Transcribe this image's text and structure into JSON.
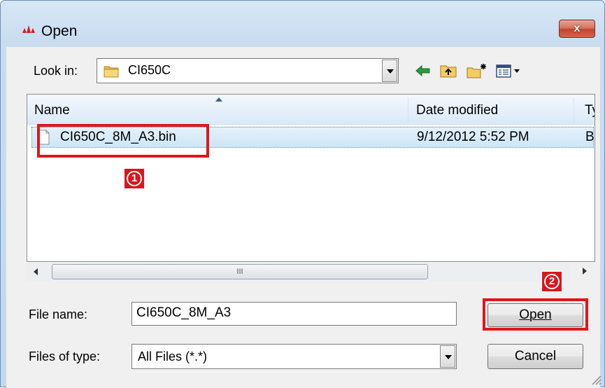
{
  "window": {
    "title": "Open",
    "close_label": "x"
  },
  "look_in": {
    "label": "Look in:",
    "folder": "CI650C",
    "folder_icon": "folder-icon"
  },
  "toolbar": {
    "back_icon": "back-arrow-icon",
    "up_icon": "up-folder-icon",
    "new_folder_icon": "new-folder-icon",
    "views_icon": "views-menu-icon"
  },
  "file_list": {
    "columns": [
      "Name",
      "Date modified",
      "Ty"
    ],
    "rows": [
      {
        "name": "CI650C_8M_A3.bin",
        "date_modified": "9/12/2012 5:52 PM",
        "type": "BI"
      }
    ]
  },
  "scrollbar": {
    "thumb_grip": "III"
  },
  "file_name": {
    "label": "File name:",
    "value": "CI650C_8M_A3"
  },
  "file_type": {
    "label": "Files of type:",
    "value": "All Files (*.*)"
  },
  "buttons": {
    "open_label": "Open",
    "cancel_label": "Cancel"
  },
  "annotations": {
    "badge_1": "1",
    "badge_2": "2",
    "highlight_color": "#e0161b"
  },
  "colors": {
    "selection": "#cde6f7",
    "title_bar": "#c9dcf0",
    "close_button": "#c2452c"
  }
}
